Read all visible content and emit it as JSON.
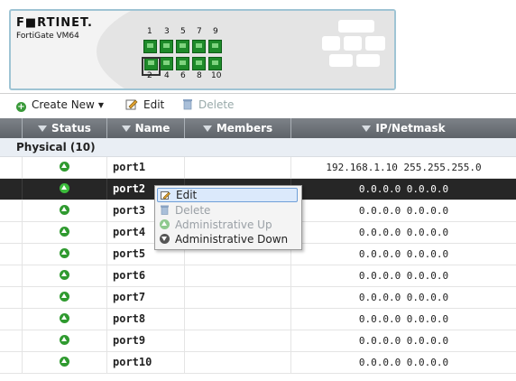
{
  "device": {
    "brand": "F■RTINET.",
    "model": "FortiGate VM64",
    "top_port_numbers": [
      "1",
      "3",
      "5",
      "7",
      "9"
    ],
    "bottom_port_numbers": [
      "2",
      "4",
      "6",
      "8",
      "10"
    ],
    "selected_port": "2"
  },
  "toolbar": {
    "create_new": "Create New",
    "edit": "Edit",
    "delete": "Delete"
  },
  "table": {
    "headers": {
      "status": "Status",
      "name": "Name",
      "members": "Members",
      "ip": "IP/Netmask"
    },
    "group_label": "Physical (10)",
    "rows": [
      {
        "status": "up",
        "name": "port1",
        "members": "",
        "ip": "192.168.1.10 255.255.255.0"
      },
      {
        "status": "up",
        "name": "port2",
        "members": "",
        "ip": "0.0.0.0 0.0.0.0",
        "selected": true
      },
      {
        "status": "up",
        "name": "port3",
        "members": "",
        "ip": "0.0.0.0 0.0.0.0"
      },
      {
        "status": "up",
        "name": "port4",
        "members": "",
        "ip": "0.0.0.0 0.0.0.0"
      },
      {
        "status": "up",
        "name": "port5",
        "members": "",
        "ip": "0.0.0.0 0.0.0.0"
      },
      {
        "status": "up",
        "name": "port6",
        "members": "",
        "ip": "0.0.0.0 0.0.0.0"
      },
      {
        "status": "up",
        "name": "port7",
        "members": "",
        "ip": "0.0.0.0 0.0.0.0"
      },
      {
        "status": "up",
        "name": "port8",
        "members": "",
        "ip": "0.0.0.0 0.0.0.0"
      },
      {
        "status": "up",
        "name": "port9",
        "members": "",
        "ip": "0.0.0.0 0.0.0.0"
      },
      {
        "status": "up",
        "name": "port10",
        "members": "",
        "ip": "0.0.0.0 0.0.0.0"
      }
    ]
  },
  "context_menu": {
    "items": [
      {
        "label": "Edit",
        "icon": "edit-icon",
        "enabled": true,
        "hover": true
      },
      {
        "label": "Delete",
        "icon": "trash-icon",
        "enabled": false
      },
      {
        "label": "Administrative Up",
        "icon": "arrow-up-icon",
        "enabled": false
      },
      {
        "label": "Administrative Down",
        "icon": "arrow-down-icon",
        "enabled": true
      }
    ]
  },
  "colors": {
    "accent": "#2f9a2f",
    "header_bg": "#6b7076",
    "selected_row": "#262626",
    "menu_hover": "#dbe9fb"
  }
}
